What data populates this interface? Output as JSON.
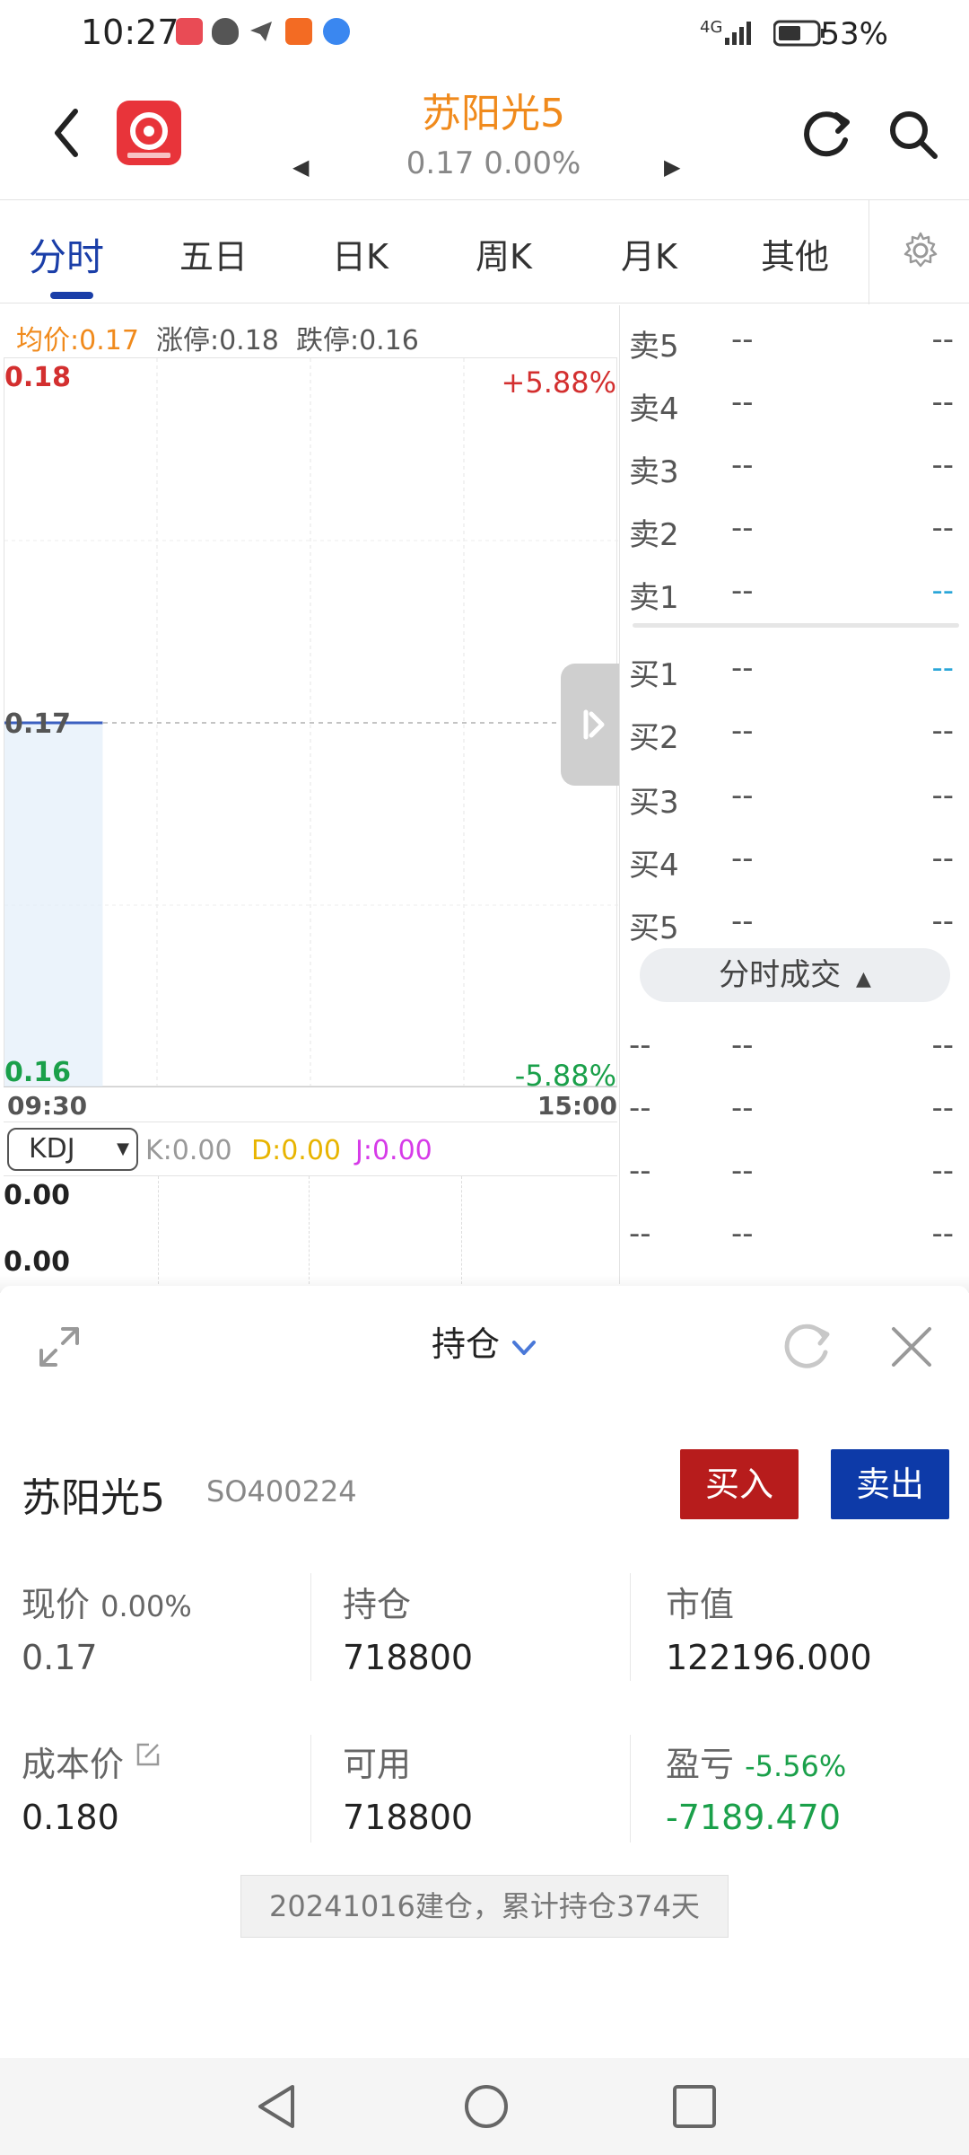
{
  "status": {
    "time": "10:27",
    "network": "4G",
    "battery": "53%"
  },
  "header": {
    "title": "苏阳光5",
    "price": "0.17",
    "change_pct": "0.00%"
  },
  "tabs": [
    {
      "label": "分时",
      "active": true
    },
    {
      "label": "五日"
    },
    {
      "label": "日K"
    },
    {
      "label": "周K"
    },
    {
      "label": "月K"
    },
    {
      "label": "其他"
    }
  ],
  "chart_info": {
    "avg": "均价:0.17",
    "limit_up": "涨停:0.18",
    "limit_down": "跌停:0.16"
  },
  "chart_data": {
    "type": "line",
    "x": [
      "09:30"
    ],
    "series": [
      {
        "values": [
          0.17
        ]
      }
    ],
    "ylim": [
      0.16,
      0.18
    ],
    "y_ticks": [
      "0.18",
      "0.17",
      "0.16"
    ],
    "pct_top": "+5.88%",
    "pct_bottom": "-5.88%",
    "x_ticks": [
      "09:30",
      "15:00"
    ],
    "grid": true
  },
  "indicator": {
    "name": "KDJ",
    "k": "K:0.00",
    "d": "D:0.00",
    "j": "J:0.00",
    "v1": "0.00",
    "v2": "0.00"
  },
  "orderbook": {
    "rows": [
      {
        "label": "卖5",
        "price": "--",
        "vol": "--"
      },
      {
        "label": "卖4",
        "price": "--",
        "vol": "--"
      },
      {
        "label": "卖3",
        "price": "--",
        "vol": "--"
      },
      {
        "label": "卖2",
        "price": "--",
        "vol": "--"
      },
      {
        "label": "卖1",
        "price": "--",
        "vol": "--"
      },
      {
        "label": "买1",
        "price": "--",
        "vol": "--"
      },
      {
        "label": "买2",
        "price": "--",
        "vol": "--"
      },
      {
        "label": "买3",
        "price": "--",
        "vol": "--"
      },
      {
        "label": "买4",
        "price": "--",
        "vol": "--"
      },
      {
        "label": "买5",
        "price": "--",
        "vol": "--"
      }
    ],
    "ticks_label": "分时成交",
    "ticks": [
      {
        "t": "--",
        "p": "--",
        "v": "--"
      },
      {
        "t": "--",
        "p": "--",
        "v": "--"
      },
      {
        "t": "--",
        "p": "--",
        "v": "--"
      },
      {
        "t": "--",
        "p": "--",
        "v": "--"
      }
    ]
  },
  "sheet": {
    "title": "持仓",
    "stock_name": "苏阳光5",
    "stock_code": "SO400224",
    "buy_label": "买入",
    "sell_label": "卖出",
    "price_label": "现价",
    "price_pct": "0.00%",
    "price_value": "0.17",
    "holding_label": "持仓",
    "holding_value": "718800",
    "market_label": "市值",
    "market_value": "122196.000",
    "cost_label": "成本价",
    "cost_value": "0.180",
    "avail_label": "可用",
    "avail_value": "718800",
    "pnl_label": "盈亏",
    "pnl_pct": "-5.56%",
    "pnl_value": "-7189.470",
    "note": "20241016建仓，累计持仓374天"
  },
  "colors": {
    "accent": "#f08a1c",
    "up": "#d32f2f",
    "down": "#1aa04a",
    "brand": "#1a3ea8"
  }
}
